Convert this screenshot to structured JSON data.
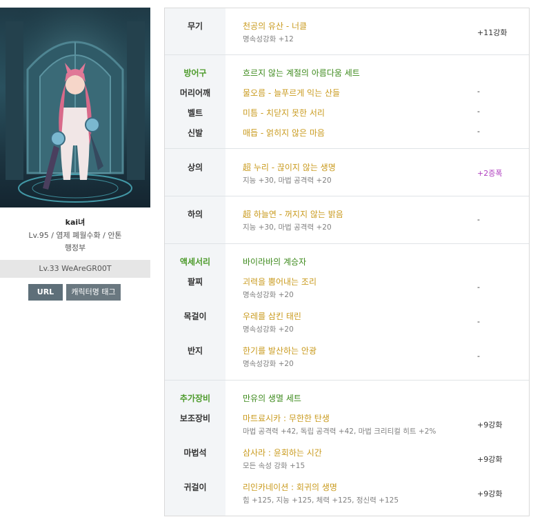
{
  "character": {
    "name": "kai녀",
    "info_line1": "Lv.95 / 염제 폐월수화 / 안톤",
    "info_line2": "행정부",
    "guild": "Lv.33 WeAreGR00T",
    "url_button": "URL",
    "tag_button": "캐릭터명 태그"
  },
  "weapon": {
    "slot": "무기",
    "name": "천공의 유산 - 너클",
    "sub": "명속성강화 +12",
    "reinforce": "+11강화"
  },
  "armor": {
    "group": "방어구",
    "set_name": "흐르지 않는 계절의 아름다움 세트",
    "items": [
      {
        "slot": "머리어깨",
        "name": "물오름 - 늘푸르게 익는 산들",
        "reinforce": "-"
      },
      {
        "slot": "벨트",
        "name": "미틈 - 치닫지 못한 서리",
        "reinforce": "-"
      },
      {
        "slot": "신발",
        "name": "매듭 - 얽히지 않은 마음",
        "reinforce": "-"
      }
    ]
  },
  "top": {
    "slot": "상의",
    "name": "超 누리 - 끊이지 않는 생명",
    "sub": "지능 +30, 마법 공격력 +20",
    "reinforce": "+2증폭"
  },
  "bottom": {
    "slot": "하의",
    "name": "超 하늘연 - 꺼지지 않는 밝음",
    "sub": "지능 +30, 마법 공격력 +20",
    "reinforce": "-"
  },
  "accessory": {
    "group": "액세서리",
    "set_name": "바이라바의 계승자",
    "items": [
      {
        "slot": "팔찌",
        "name": "괴력을 뿜어내는 조리",
        "sub": "명속성강화 +20",
        "reinforce": "-"
      },
      {
        "slot": "목걸이",
        "name": "우레를 삼킨 태린",
        "sub": "명속성강화 +20",
        "reinforce": "-"
      },
      {
        "slot": "반지",
        "name": "한기를 발산하는 안광",
        "sub": "명속성강화 +20",
        "reinforce": "-"
      }
    ]
  },
  "extra": {
    "group": "추가장비",
    "set_name": "만유의 생멸 세트",
    "items": [
      {
        "slot": "보조장비",
        "name": "마트료시카 : 무한한 탄생",
        "sub": "마법 공격력 +42, 독립 공격력 +42, 마법 크리티컬 히트 +2%",
        "reinforce": "+9강화"
      },
      {
        "slot": "마법석",
        "name": "삼사라 : 윤회하는 시간",
        "sub": "모든 속성 강화 +15",
        "reinforce": "+9강화"
      },
      {
        "slot": "귀걸이",
        "name": "리인카네이션 : 회귀의 생명",
        "sub": "힘 +125, 지능 +125, 체력 +125, 정신력 +125",
        "reinforce": "+9강화"
      }
    ]
  }
}
